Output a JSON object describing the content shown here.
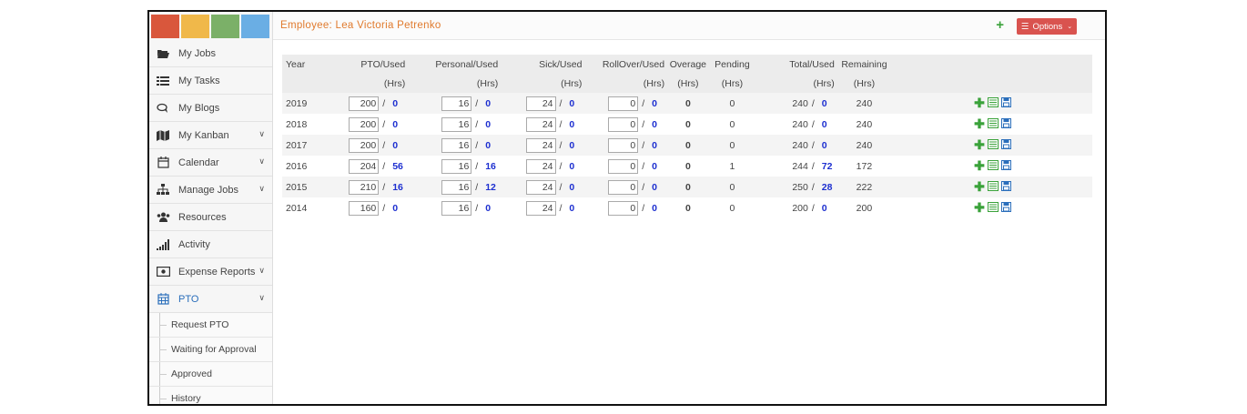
{
  "logo_colors": [
    "#d9573c",
    "#f0b84a",
    "#7bb068",
    "#6aaee4"
  ],
  "sidebar": {
    "items": [
      {
        "label": "My Jobs",
        "icon": "folder-open-icon",
        "has_chevron": false
      },
      {
        "label": "My Tasks",
        "icon": "tasks-list-icon",
        "has_chevron": false
      },
      {
        "label": "My Blogs",
        "icon": "comments-icon",
        "has_chevron": false
      },
      {
        "label": "My Kanban",
        "icon": "map-icon",
        "has_chevron": true
      },
      {
        "label": "Calendar",
        "icon": "calendar-icon",
        "has_chevron": true
      },
      {
        "label": "Manage Jobs",
        "icon": "sitemap-icon",
        "has_chevron": true
      },
      {
        "label": "Resources",
        "icon": "users-icon",
        "has_chevron": false
      },
      {
        "label": "Activity",
        "icon": "signal-bars-icon",
        "has_chevron": false
      },
      {
        "label": "Expense Reports",
        "icon": "money-icon",
        "has_chevron": true
      },
      {
        "label": "PTO",
        "icon": "calendar-grid-icon",
        "has_chevron": true,
        "active": true
      }
    ],
    "pto_subitems": [
      "Request PTO",
      "Waiting for Approval",
      "Approved",
      "History"
    ]
  },
  "header": {
    "title": "Employee: Lea Victoria Petrenko",
    "add_label": "+",
    "options_label": "Options"
  },
  "table": {
    "headers": [
      "Year",
      "PTO/Used",
      "Personal/Used",
      "Sick/Used",
      "RollOver/Used",
      "Overage",
      "Pending",
      "Total/Used",
      "Remaining"
    ],
    "units": [
      "",
      "(Hrs)",
      "(Hrs)",
      "(Hrs)",
      "(Hrs)",
      "(Hrs)",
      "(Hrs)",
      "(Hrs)",
      "(Hrs)"
    ],
    "rows": [
      {
        "year": "2019",
        "pto": "200",
        "pto_used": "0",
        "personal": "16",
        "personal_used": "0",
        "sick": "24",
        "sick_used": "0",
        "rollover": "0",
        "rollover_used": "0",
        "overage": "0",
        "pending": "0",
        "total": "240",
        "total_used": "0",
        "remaining": "240"
      },
      {
        "year": "2018",
        "pto": "200",
        "pto_used": "0",
        "personal": "16",
        "personal_used": "0",
        "sick": "24",
        "sick_used": "0",
        "rollover": "0",
        "rollover_used": "0",
        "overage": "0",
        "pending": "0",
        "total": "240",
        "total_used": "0",
        "remaining": "240"
      },
      {
        "year": "2017",
        "pto": "200",
        "pto_used": "0",
        "personal": "16",
        "personal_used": "0",
        "sick": "24",
        "sick_used": "0",
        "rollover": "0",
        "rollover_used": "0",
        "overage": "0",
        "pending": "0",
        "total": "240",
        "total_used": "0",
        "remaining": "240"
      },
      {
        "year": "2016",
        "pto": "204",
        "pto_used": "56",
        "personal": "16",
        "personal_used": "16",
        "sick": "24",
        "sick_used": "0",
        "rollover": "0",
        "rollover_used": "0",
        "overage": "0",
        "pending": "1",
        "total": "244",
        "total_used": "72",
        "remaining": "172"
      },
      {
        "year": "2015",
        "pto": "210",
        "pto_used": "16",
        "personal": "16",
        "personal_used": "12",
        "sick": "24",
        "sick_used": "0",
        "rollover": "0",
        "rollover_used": "0",
        "overage": "0",
        "pending": "0",
        "total": "250",
        "total_used": "28",
        "remaining": "222"
      },
      {
        "year": "2014",
        "pto": "160",
        "pto_used": "0",
        "personal": "16",
        "personal_used": "0",
        "sick": "24",
        "sick_used": "0",
        "rollover": "0",
        "rollover_used": "0",
        "overage": "0",
        "pending": "0",
        "total": "200",
        "total_used": "0",
        "remaining": "200"
      }
    ],
    "row_actions": [
      "add-icon",
      "list-icon",
      "save-icon"
    ]
  },
  "colors": {
    "title": "#e07a2d",
    "used_value": "#1d2fd0",
    "options_button": "#d9534f",
    "add_green": "#3aa23a",
    "active_nav": "#2a6ebb"
  }
}
